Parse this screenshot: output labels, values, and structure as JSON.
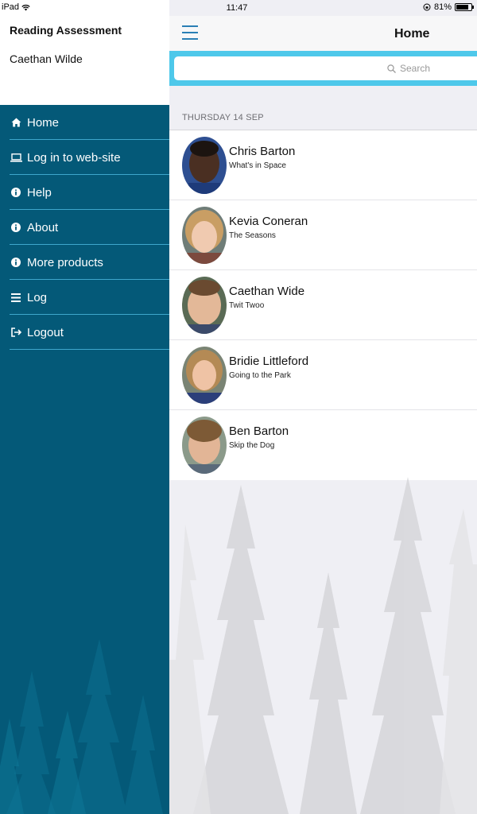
{
  "status_bar": {
    "carrier": "iPad",
    "time": "11:47",
    "battery": "81%",
    "battery_level": 0.81
  },
  "drawer": {
    "app_title": "Reading Assessment",
    "user_name": "Caethan Wilde",
    "items": [
      {
        "label": "Home",
        "icon": "home-icon"
      },
      {
        "label": "Log in to web-site",
        "icon": "laptop-icon"
      },
      {
        "label": "Help",
        "icon": "info-icon"
      },
      {
        "label": "About",
        "icon": "info-icon"
      },
      {
        "label": "More products",
        "icon": "info-icon"
      },
      {
        "label": "Log",
        "icon": "list-icon"
      },
      {
        "label": "Logout",
        "icon": "sign-out-icon"
      }
    ]
  },
  "header": {
    "title": "Home"
  },
  "search": {
    "placeholder": "Search"
  },
  "section": {
    "date": "THURSDAY 14 SEP"
  },
  "students": [
    {
      "name": "Chris Barton",
      "book": "What's in Space"
    },
    {
      "name": "Kevia Coneran",
      "book": "The Seasons"
    },
    {
      "name": "Caethan Wide",
      "book": "Twit Twoo"
    },
    {
      "name": "Bridie  Littleford",
      "book": "Going to the Park"
    },
    {
      "name": "Ben Barton",
      "book": "Skip the Dog"
    }
  ],
  "colors": {
    "drawer_bg": "#045978",
    "accent": "#4ec8ea",
    "divider": "#3ea7cc",
    "panel_bg": "#efeff4"
  }
}
